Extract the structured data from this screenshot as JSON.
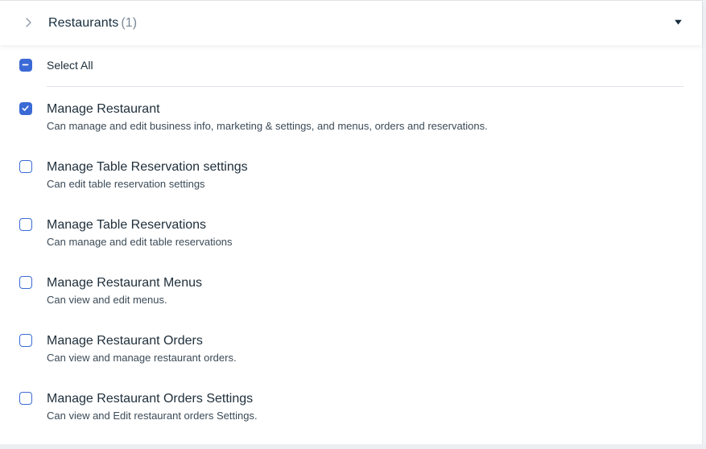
{
  "header": {
    "title": "Restaurants",
    "count": "(1)"
  },
  "select_all": {
    "label": "Select All",
    "state": "indeterminate"
  },
  "permissions": [
    {
      "title": "Manage Restaurant",
      "description": "Can manage and edit business info, marketing & settings, and menus, orders and reservations.",
      "checked": true
    },
    {
      "title": "Manage Table Reservation settings",
      "description": "Can edit table reservation settings",
      "checked": false
    },
    {
      "title": "Manage Table Reservations",
      "description": "Can manage and edit table reservations",
      "checked": false
    },
    {
      "title": "Manage Restaurant Menus",
      "description": "Can view and edit menus.",
      "checked": false
    },
    {
      "title": "Manage Restaurant Orders",
      "description": "Can view and manage restaurant orders.",
      "checked": false
    },
    {
      "title": "Manage Restaurant Orders Settings",
      "description": "Can view and Edit restaurant orders Settings.",
      "checked": false
    }
  ],
  "icons": {
    "expand": "chevron-right-icon",
    "collapse": "caret-down-icon",
    "checked": "checkmark-icon",
    "indeterminate": "minus-icon"
  },
  "colors": {
    "accent": "#3b6ad6",
    "text_primary": "#20303c",
    "text_secondary": "#3b4a57",
    "count": "#7a8794"
  }
}
